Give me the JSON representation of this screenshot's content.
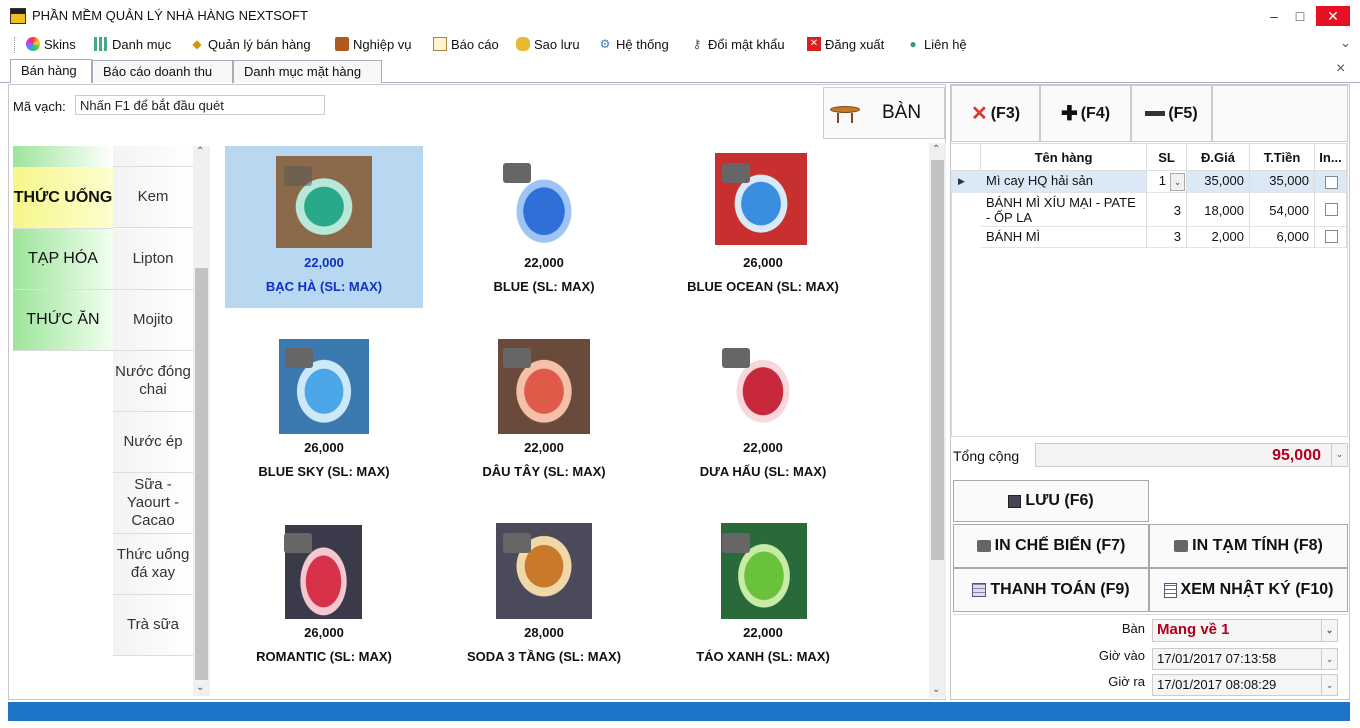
{
  "window": {
    "title": "PHẦN MỀM QUẢN LÝ NHÀ HÀNG NEXTSOFT",
    "minimize": "–",
    "maximize": "□",
    "close": "✕"
  },
  "menu": [
    "Skins",
    "Danh mục",
    "Quản lý bán hàng",
    "Nghiệp vụ",
    "Báo cáo",
    "Sao lưu",
    "Hệ thống",
    "Đổi mật khẩu",
    "Đăng xuất",
    "Liên hệ"
  ],
  "menu_overflow": "⌄",
  "tabs": [
    "Bán hàng",
    "Báo cáo doanh thu",
    "Danh mục mặt hàng"
  ],
  "tab_close": "×",
  "barcode": {
    "label": "Mã vạch:",
    "value": "Nhấn F1 để bắt đầu quét"
  },
  "table_button": "BÀN",
  "categories": [
    "THỨC UỐNG",
    "TẠP HÓA",
    "THỨC ĂN"
  ],
  "subcategories": [
    "Kem",
    "Lipton",
    "Mojito",
    "Nước đóng chai",
    "Nước ép",
    "Sữa - Yaourt - Cacao",
    "Thức uống đá xay",
    "Trà sữa"
  ],
  "products": [
    {
      "price": "22,000",
      "name": "BẠC HÀ (SL: MAX)",
      "selected": true,
      "color": "#2aa88a"
    },
    {
      "price": "22,000",
      "name": "BLUE (SL: MAX)",
      "selected": false,
      "color": "#2f6fd8"
    },
    {
      "price": "26,000",
      "name": "BLUE OCEAN (SL: MAX)",
      "selected": false,
      "color": "#3a8ee0"
    },
    {
      "price": "26,000",
      "name": "BLUE SKY (SL: MAX)",
      "selected": false,
      "color": "#4aa6e6"
    },
    {
      "price": "22,000",
      "name": "DÂU TÂY (SL: MAX)",
      "selected": false,
      "color": "#e05a4a"
    },
    {
      "price": "22,000",
      "name": "DƯA HẤU (SL: MAX)",
      "selected": false,
      "color": "#c8283c"
    },
    {
      "price": "26,000",
      "name": "ROMANTIC (SL: MAX)",
      "selected": false,
      "color": "#d8324a"
    },
    {
      "price": "28,000",
      "name": "SODA 3 TẦNG (SL: MAX)",
      "selected": false,
      "color": "#c87a2a"
    },
    {
      "price": "22,000",
      "name": "TÁO XANH (SL: MAX)",
      "selected": false,
      "color": "#6ac23a"
    }
  ],
  "order_buttons": {
    "delete": "(F3)",
    "add": "(F4)",
    "minus": "(F5)"
  },
  "grid": {
    "headers": [
      "Tên hàng",
      "SL",
      "Đ.Giá",
      "T.Tiền",
      "In..."
    ],
    "rows": [
      {
        "name": "Mì cay HQ hải sản",
        "qty": "1",
        "price": "35,000",
        "total": "35,000"
      },
      {
        "name": "BÁNH MÌ XÍU MẠI - PATE - ỐP LA",
        "qty": "3",
        "price": "18,000",
        "total": "54,000"
      },
      {
        "name": "BÁNH MÌ",
        "qty": "3",
        "price": "2,000",
        "total": "6,000"
      }
    ]
  },
  "total": {
    "label": "Tổng cộng",
    "value": "95,000"
  },
  "actions": {
    "save": "LƯU (F6)",
    "print_kitchen": "IN CHẾ BIẾN (F7)",
    "print_temp": "IN TẠM TÍNH (F8)",
    "pay": "THANH TOÁN (F9)",
    "log": "XEM NHẬT KÝ (F10)"
  },
  "info": {
    "table_label": "Bàn",
    "table_value": "Mang về 1",
    "time_in_label": "Giờ vào",
    "time_in_value": "17/01/2017 07:13:58",
    "time_out_label": "Giờ ra",
    "time_out_value": "17/01/2017 08:08:29"
  },
  "colors": {
    "accent": "#1e74c8",
    "selected_product": "#b8d8f2",
    "category_active": "#fdfda0",
    "category_green": "#b9efaa",
    "total_red": "#b00020"
  }
}
